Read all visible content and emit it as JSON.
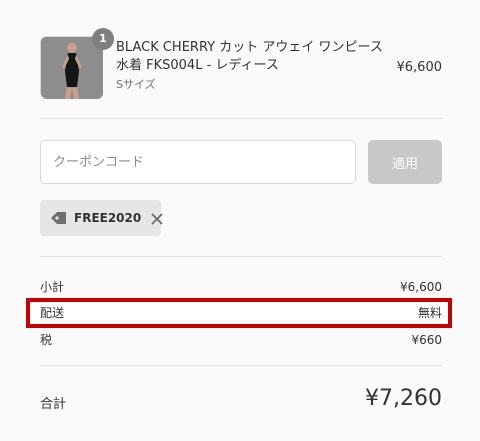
{
  "product": {
    "quantity": "1",
    "title": "BLACK CHERRY カット アウェイ ワンピース 水着 FKS004L - レディース",
    "variant": "Sサイズ",
    "price": "¥6,600"
  },
  "coupon": {
    "placeholder": "クーポンコード",
    "apply_label": "適用",
    "applied_code": "FREE2020"
  },
  "summary": {
    "subtotal_label": "小計",
    "subtotal_value": "¥6,600",
    "shipping_label": "配送",
    "shipping_value": "無料",
    "tax_label": "税",
    "tax_value": "¥660",
    "total_label": "合計",
    "total_value": "¥7,260"
  },
  "colors": {
    "highlight": "#c40000",
    "apply_button": "#c8c8c8"
  }
}
